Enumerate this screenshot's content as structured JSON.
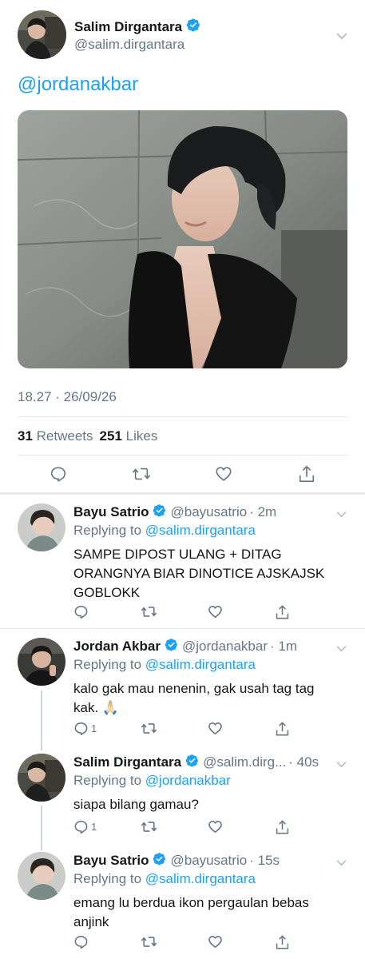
{
  "main": {
    "display_name": "Salim Dirgantara",
    "handle": "@salim.dirgantara",
    "mention": "@jordanakbar",
    "timestamp": "18.27 · 26/09/26",
    "retweets_count": "31",
    "retweets_label": "Retweets",
    "likes_count": "251",
    "likes_label": "Likes"
  },
  "replies": [
    {
      "display_name": "Bayu Satrio",
      "handle": "@bayusatrio",
      "time": "· 2m",
      "replying_prefix": "Replying to",
      "replying_to": "@salim.dirgantara",
      "text": "SAMPE DIPOST ULANG + DITAG ORANGNYA BIAR DINOTICE AJSKAJSK GOBLOKK",
      "reply_count": ""
    },
    {
      "display_name": "Jordan Akbar",
      "handle": "@jordanakbar",
      "time": "· 1m",
      "replying_prefix": "Replying to",
      "replying_to": "@salim.dirgantara",
      "text": "kalo gak mau nenenin, gak usah tag tag kak. 🙏🏻",
      "reply_count": "1"
    },
    {
      "display_name": "Salim Dirgantara",
      "handle": "@salim.dirg...",
      "time": "· 40s",
      "replying_prefix": "Replying to",
      "replying_to": "@jordanakbar",
      "text": "siapa bilang gamau?",
      "reply_count": "1"
    },
    {
      "display_name": "Bayu Satrio",
      "handle": "@bayusatrio",
      "time": "· 15s",
      "replying_prefix": "Replying to",
      "replying_to": "@salim.dirgantara",
      "text": "emang lu berdua ikon pergaulan bebas anjink",
      "reply_count": ""
    }
  ],
  "icons": {
    "verified": "verified-badge-icon",
    "reply": "reply-icon",
    "retweet": "retweet-icon",
    "like": "heart-icon",
    "share": "share-icon",
    "more": "chevron-down-icon"
  },
  "colors": {
    "accent": "#1da1f2",
    "secondary_text": "#657786",
    "divider": "#e1e8ed"
  }
}
